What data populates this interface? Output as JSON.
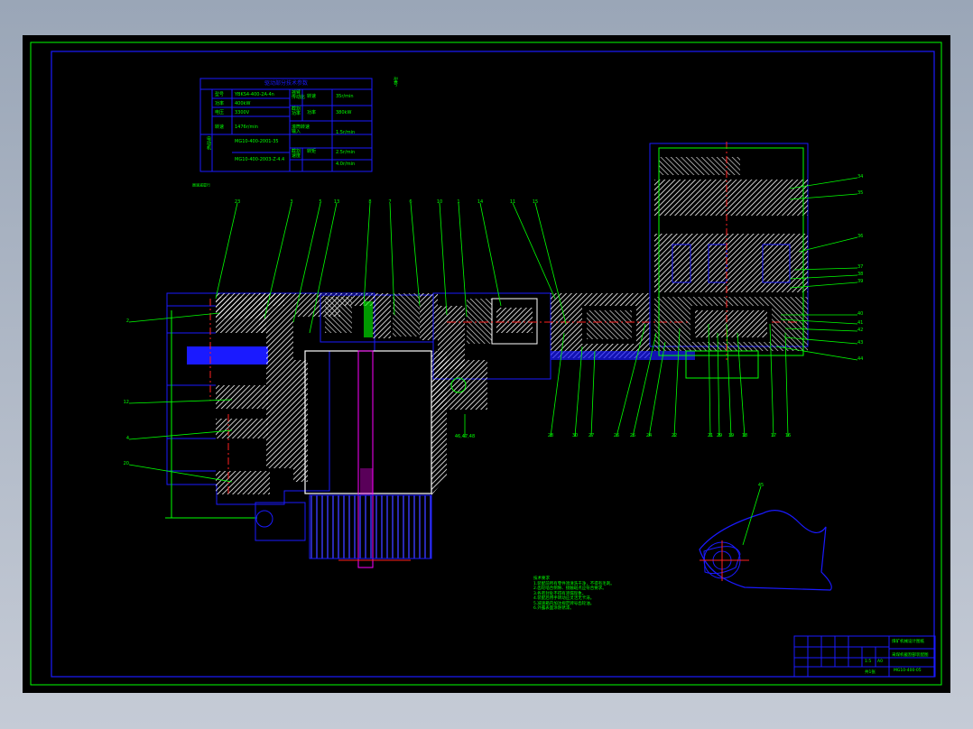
{
  "colors": {
    "canvas": "#000000",
    "frame": "#1a1aff",
    "leader": "#00ff00",
    "hatch": "#ffffff",
    "centerline": "#ff2020",
    "magenta": "#ff00ff",
    "background": "#a7b1c0"
  },
  "table": {
    "title": "驱动部分技术参数",
    "rows": [
      {
        "group": "电动机",
        "label": "型号",
        "value": "YBKS4-400-2A·4n"
      },
      {
        "group": "",
        "label": "功率",
        "value": "400kW"
      },
      {
        "group": "",
        "label": "电压",
        "value": "3300V"
      },
      {
        "group": "",
        "label": "转速",
        "value": "1476r/min"
      },
      {
        "group": "行星减速器",
        "label": "",
        "value": "MG10-400-2001-35"
      },
      {
        "group": "",
        "label": "",
        "value": "MG10-400-2003-Z·4.4"
      }
    ],
    "right_rows": [
      {
        "label": "摇臂\n传动比",
        "label2": "转速",
        "value": "35r/min"
      },
      {
        "label": "截割\n功率",
        "label2": "功率",
        "value": "380kW"
      },
      {
        "label": "滚筒转速\n输入",
        "label2": "",
        "value": "1.5r/min"
      },
      {
        "label": "截割\n速度",
        "label2": "转矩",
        "value": "2.5r/min"
      },
      {
        "label": "",
        "label2": "",
        "value": "4.0r/min"
      }
    ]
  },
  "notes": {
    "heading": "技术要求",
    "lines": [
      "1.装配前所有零件须清洗干净，不得有毛刺。",
      "2.齿轮啮合侧隙、接触斑点应符合要求。",
      "3.各密封处不得有渗漏现象。",
      "4.装配后用手转动应灵活无卡滞。",
      "5.减速箱内加注规定牌号齿轮油。",
      "6.外露表面涂防锈漆。"
    ]
  },
  "title_block": {
    "company": "煤矿机械设计图纸",
    "drawing_name": "采煤机截割部装配图",
    "drawing_number": "MG10-400-05",
    "scale": "1:5",
    "sheet": "共1张",
    "material_mark": "A0"
  },
  "callouts": {
    "top": [
      "23",
      "3",
      "5",
      "13",
      "8",
      "7",
      "6",
      "10",
      "1",
      "14",
      "11",
      "15"
    ],
    "left": [
      "2",
      "12",
      "4",
      "20"
    ],
    "bottom": [
      "28",
      "30",
      "27",
      "26",
      "25",
      "24",
      "22",
      "21",
      "29",
      "19",
      "18",
      "17",
      "16"
    ],
    "right": [
      "34",
      "35",
      "36",
      "37",
      "38",
      "39",
      "40",
      "41",
      "42",
      "43",
      "44"
    ],
    "misc": [
      "46,47,48",
      "45"
    ]
  }
}
